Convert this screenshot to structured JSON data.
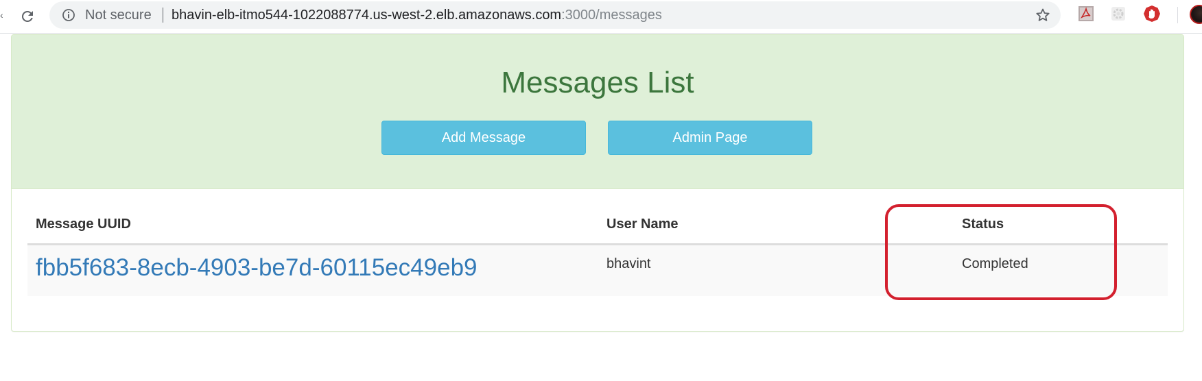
{
  "browser": {
    "security_label": "Not secure",
    "url_host": "bhavin-elb-itmo544-1022088774.us-west-2.elb.amazonaws.com",
    "url_path": ":3000/messages",
    "icons": [
      "reload-icon",
      "info-icon",
      "star-icon",
      "pdf-extension-icon",
      "gear-extension-icon",
      "stop-hand-extension-icon",
      "profile-avatar"
    ]
  },
  "page": {
    "title": "Messages List",
    "buttons": {
      "add_message": "Add Message",
      "admin_page": "Admin Page"
    },
    "colors": {
      "heading_bg": "#dff0d8",
      "title_text": "#3c763d",
      "button_bg": "#5bc0de",
      "link": "#337ab7",
      "highlight": "#d3202e"
    }
  },
  "table": {
    "headers": {
      "uuid": "Message UUID",
      "user": "User Name",
      "status": "Status"
    },
    "rows": [
      {
        "uuid": "fbb5f683-8ecb-4903-be7d-60115ec49eb9",
        "user": "bhavint",
        "status": "Completed"
      }
    ]
  }
}
